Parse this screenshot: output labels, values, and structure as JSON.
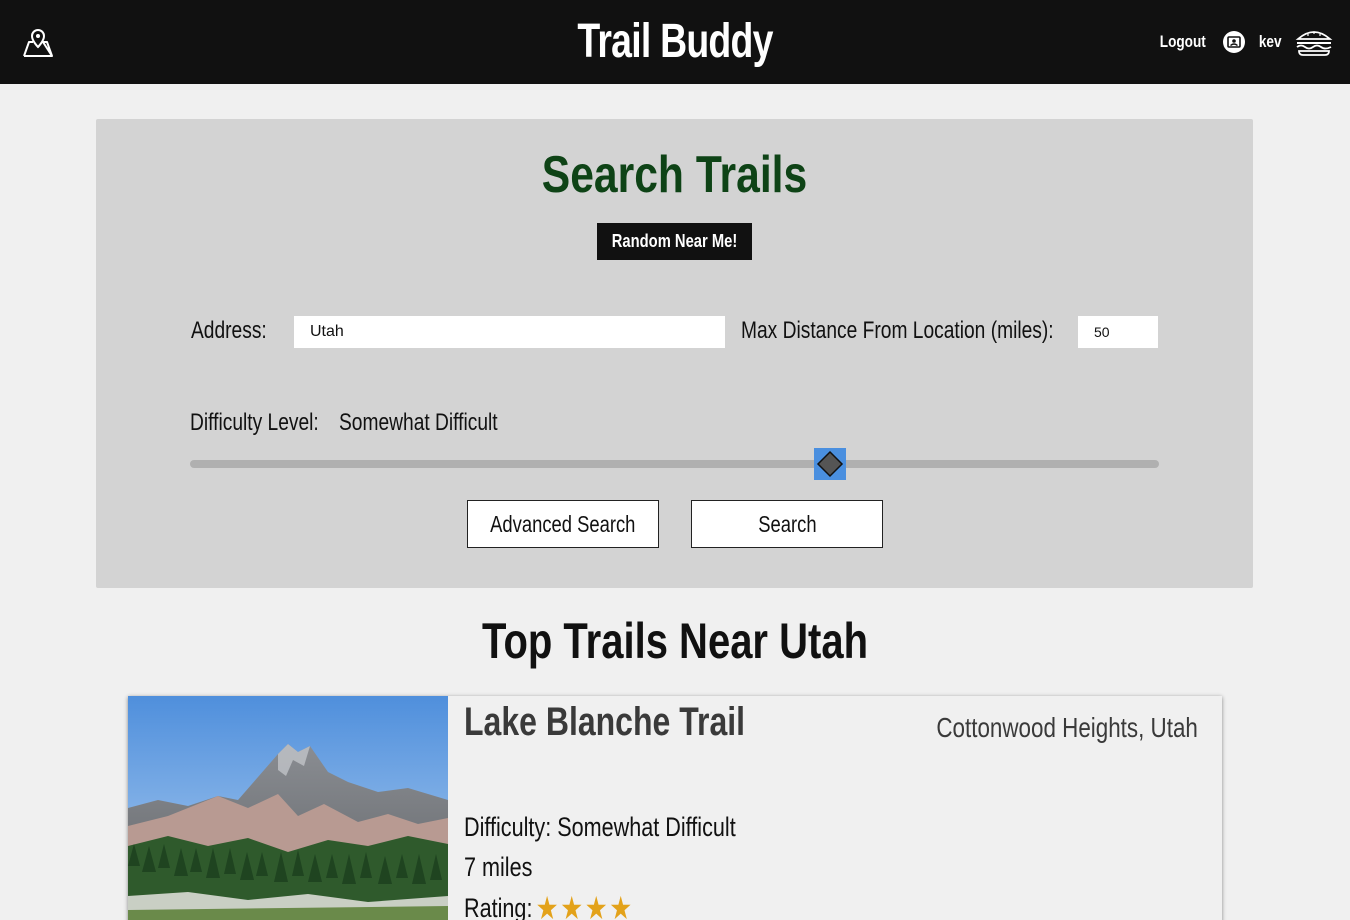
{
  "header": {
    "brand": "Trail Buddy",
    "logout_label": "Logout",
    "username": "kev"
  },
  "search": {
    "title": "Search Trails",
    "random_button": "Random Near Me!",
    "address_label": "Address:",
    "address_value": "Utah",
    "distance_label": "Max Distance From Location (miles):",
    "distance_value": "50",
    "difficulty_label": "Difficulty Level:",
    "difficulty_value": "Somewhat Difficult",
    "difficulty_slider_fraction": 0.66,
    "advanced_button": "Advanced Search",
    "search_button": "Search"
  },
  "results": {
    "title": "Top Trails Near Utah",
    "trails": [
      {
        "name": "Lake Blanche Trail",
        "location": "Cottonwood Heights, Utah",
        "difficulty_text": "Difficulty: Somewhat Difficult",
        "length_text": "7 miles",
        "rating_label": "Rating:",
        "rating_stars": 4
      }
    ]
  },
  "colors": {
    "header_bg": "#111111",
    "panel_bg": "#d3d3d3",
    "title_green": "#0e4316",
    "slider_thumb": "#4a8fdf",
    "star": "#e3a21a"
  }
}
